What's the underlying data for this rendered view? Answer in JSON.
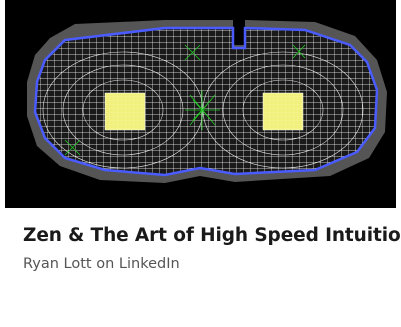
{
  "card": {
    "title": "Zen & The Art of High Speed Intuition",
    "source": "Ryan Lott on LinkedIn",
    "image_icon": "pcb-mesh-image"
  },
  "colors": {
    "image_background": "#000000",
    "board": "#555555",
    "outline": "#4a5cff",
    "mesh": "#ffffff",
    "pad": "#f0f07a",
    "mesh_accent": "#22cc22",
    "title_text": "#1a1a1a",
    "source_text": "#555555"
  }
}
